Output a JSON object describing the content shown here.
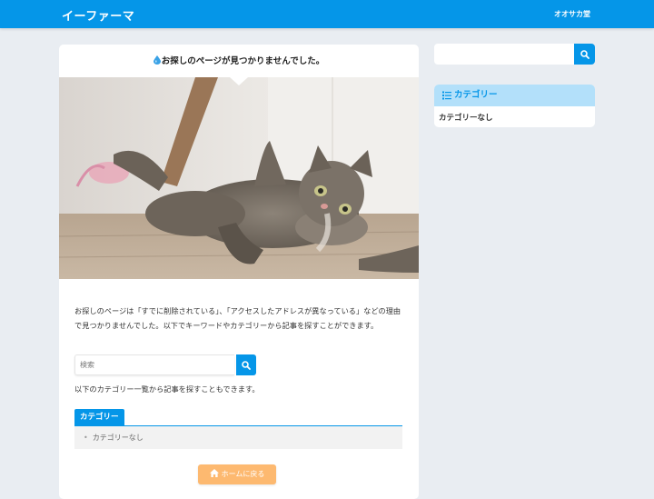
{
  "header": {
    "site_title": "イーファーマ",
    "nav_link": "オオサカ堂"
  },
  "main": {
    "page_title": "お探しのページが見つかりませんでした。",
    "intro_text": "お探しのページは「すでに削除されている」、「アクセスしたアドレスが異なっている」などの理由で見つかりませんでした。以下でキーワードやカテゴリーから記事を探すことができます。",
    "search": {
      "placeholder": "検索"
    },
    "category_note": "以下のカテゴリー一覧から記事を探すこともできます。",
    "category_label": "カテゴリー",
    "category_items": [
      "カテゴリーなし"
    ],
    "home_button": "ホームに戻る"
  },
  "sidebar": {
    "search": {
      "placeholder": ""
    },
    "category_title": "カテゴリー",
    "category_items": [
      "カテゴリーなし"
    ]
  },
  "colors": {
    "brand": "#0596e8",
    "home_button": "#fdb970",
    "sidebar_heading_bg": "#b3e0fa"
  },
  "icons": {
    "title_icon": "water-drop-icon",
    "search": "search-icon",
    "home": "home-icon",
    "category_list": "list-icon"
  }
}
